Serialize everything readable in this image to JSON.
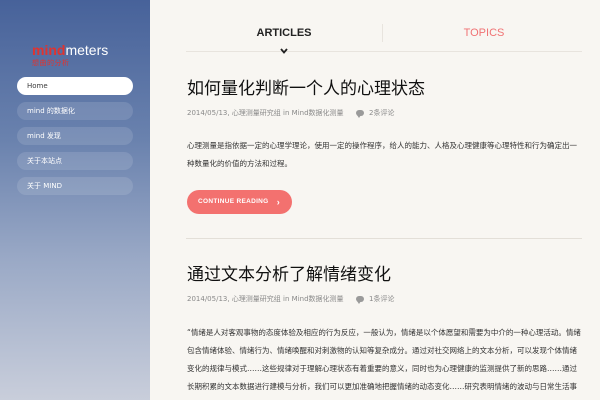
{
  "logo": {
    "mind": "mind",
    "meters": "meters",
    "subtitle": "想曲的分析"
  },
  "nav": {
    "items": [
      {
        "label": "Home",
        "active": true
      },
      {
        "label": "mind 的数据化"
      },
      {
        "label": "mind 发现"
      },
      {
        "label": "关于本站点"
      },
      {
        "label": "关于 MIND"
      }
    ]
  },
  "tabs": {
    "articles": "ARTICLES",
    "topics": "TOPICS",
    "active": "articles"
  },
  "articles": [
    {
      "title": "如何量化判断一个人的心理状态",
      "date": "2014/05/13,",
      "author": "心理测量研究组",
      "in_label": "in",
      "category": "Mind数据化测量",
      "comments": "2条评论",
      "excerpt": "心理测量是指依据一定的心理学理论，使用一定的操作程序，给人的能力、人格及心理健康等心理特性和行为确定出一种数量化的价值的方法和过程。",
      "read_more": "CONTINUE READING"
    },
    {
      "title": "通过文本分析了解情绪变化",
      "date": "2014/05/13,",
      "author": "心理测量研究组",
      "in_label": "in",
      "category": "Mind数据化测量",
      "comments": "1条评论",
      "excerpt": "“情绪是人对客观事物的态度体验及相应的行为反应，一般认为，情绪是以个体愿望和需要为中介的一种心理活动。情绪包含情绪体验、情绪行为、情绪唤醒和对刺激物的认知等复杂成分。通过对社交网络上的文本分析，可以发现个体情绪变化的规律与模式……这些规律对于理解心理状态有着重要的意义，同时也为心理健康的监测提供了新的思路……通过长期积累的文本数据进行建模与分析，我们可以更加准确地把握情绪的动态变化……研究表明情绪的波动与日常生活事件密切相关，‘正’与‘负’的情绪在时间维度上呈现出一定的‘周期’。”"
    }
  ]
}
